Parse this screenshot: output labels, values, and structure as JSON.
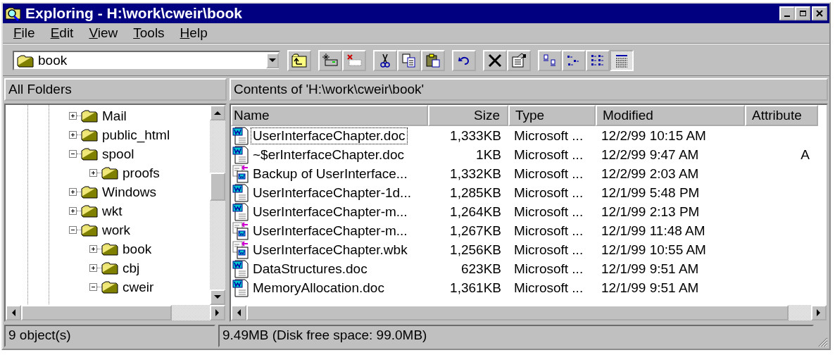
{
  "window": {
    "title": "Exploring - H:\\work\\cweir\\book"
  },
  "menu": [
    "File",
    "Edit",
    "View",
    "Tools",
    "Help"
  ],
  "address": {
    "value": "book"
  },
  "toolbar": {
    "view_modes": [
      {
        "kind": "large_icons",
        "selected": false
      },
      {
        "kind": "small_icons",
        "selected": false
      },
      {
        "kind": "list",
        "selected": false
      },
      {
        "kind": "details",
        "selected": true
      }
    ]
  },
  "folders_pane": {
    "title": "All Folders",
    "tree": [
      {
        "label": "Mail",
        "expanded": false
      },
      {
        "label": "public_html",
        "expanded": false
      },
      {
        "label": "spool",
        "expanded": true,
        "children": [
          {
            "label": "proofs",
            "expanded": false
          }
        ]
      },
      {
        "label": "Windows",
        "expanded": false
      },
      {
        "label": "wkt",
        "expanded": false
      },
      {
        "label": "work",
        "expanded": true,
        "children": [
          {
            "label": "book",
            "expanded": false
          },
          {
            "label": "cbj",
            "expanded": false
          },
          {
            "label": "cweir",
            "expanded": true
          }
        ]
      }
    ]
  },
  "contents_pane": {
    "title": "Contents of 'H:\\work\\cweir\\book'",
    "columns": [
      "Name",
      "Size",
      "Type",
      "Modified",
      "Attribute"
    ],
    "rows": [
      {
        "kind": "doc",
        "selected": true,
        "name": "UserInterfaceChapter.doc",
        "size": "1,333KB",
        "type": "Microsoft ...",
        "modified": "12/2/99 10:15 AM"
      },
      {
        "kind": "doc",
        "selected": false,
        "name": "~$erInterfaceChapter.doc",
        "size": "1KB",
        "type": "Microsoft ...",
        "modified": "12/2/99 9:47 AM",
        "attributes": "A"
      },
      {
        "kind": "backup",
        "selected": false,
        "name": "Backup of UserInterface...",
        "size": "1,332KB",
        "type": "Microsoft ...",
        "modified": "12/2/99 2:03 AM"
      },
      {
        "kind": "doc",
        "selected": false,
        "name": "UserInterfaceChapter-1d...",
        "size": "1,285KB",
        "type": "Microsoft ...",
        "modified": "12/1/99 5:48 PM"
      },
      {
        "kind": "doc",
        "selected": false,
        "name": "UserInterfaceChapter-m...",
        "size": "1,264KB",
        "type": "Microsoft ...",
        "modified": "12/1/99 2:13 PM"
      },
      {
        "kind": "backup",
        "selected": false,
        "name": "UserInterfaceChapter-m...",
        "size": "1,267KB",
        "type": "Microsoft ...",
        "modified": "12/1/99 11:48 AM"
      },
      {
        "kind": "backup",
        "selected": false,
        "name": "UserInterfaceChapter.wbk",
        "size": "1,256KB",
        "type": "Microsoft ...",
        "modified": "12/1/99 10:55 AM"
      },
      {
        "kind": "doc",
        "selected": false,
        "name": "DataStructures.doc",
        "size": "623KB",
        "type": "Microsoft ...",
        "modified": "12/1/99 9:51 AM"
      },
      {
        "kind": "doc",
        "selected": false,
        "name": "MemoryAllocation.doc",
        "size": "1,361KB",
        "type": "Microsoft ...",
        "modified": "12/1/99 9:51 AM"
      }
    ]
  },
  "status_bar": [
    "9 object(s)",
    "9.49MB (Disk free space: 99.0MB)"
  ]
}
